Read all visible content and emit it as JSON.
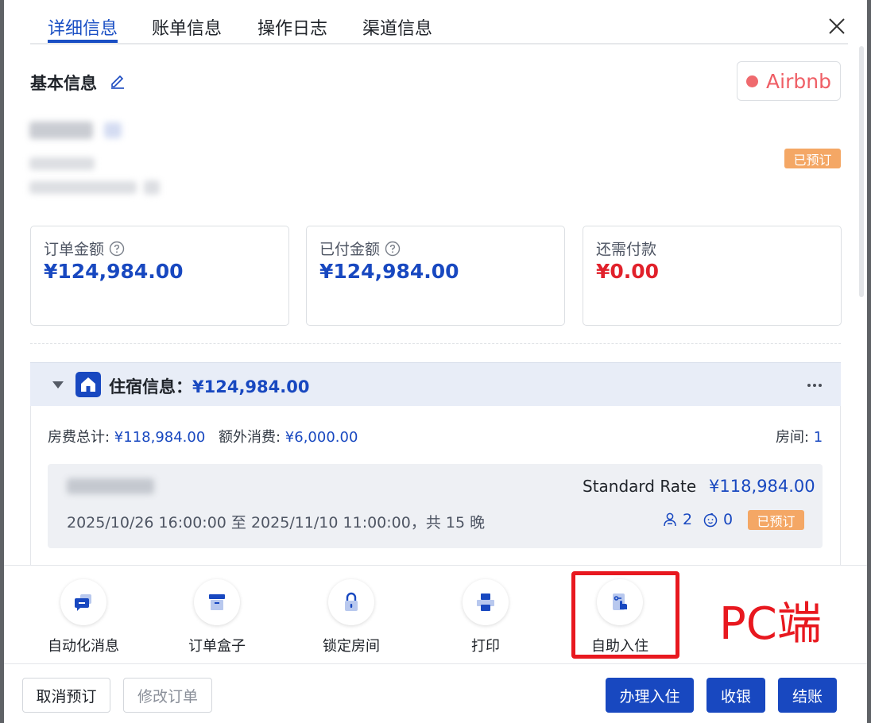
{
  "tabs": [
    "详细信息",
    "账单信息",
    "操作日志",
    "渠道信息"
  ],
  "basic": {
    "title": "基本信息",
    "channel": "Airbnb",
    "status": "已预订"
  },
  "amounts": {
    "order_label": "订单金额",
    "order_value": "¥124,984.00",
    "paid_label": "已付金额",
    "paid_value": "¥124,984.00",
    "due_label": "还需付款",
    "due_value": "¥0.00"
  },
  "lodging": {
    "title": "住宿信息：",
    "total": "¥124,984.00",
    "room_fee_label": "房费总计: ",
    "room_fee": "¥118,984.00",
    "extra_label": "额外消费: ",
    "extra": "¥6,000.00",
    "rooms_label": "房间: ",
    "rooms": "1",
    "rate_name": "Standard Rate",
    "rate_amount": "¥118,984.00",
    "date_range": "2025/10/26 16:00:00 至 2025/11/10 11:00:00，共 15 晚",
    "adults": "2",
    "children": "0",
    "room_status": "已预订"
  },
  "actions": [
    "自动化消息",
    "订单盒子",
    "锁定房间",
    "打印",
    "自助入住"
  ],
  "annotation": "PC端",
  "footer": {
    "cancel": "取消预订",
    "modify": "修改订单",
    "checkin": "办理入住",
    "cashier": "收银",
    "checkout": "结账"
  },
  "colors": {
    "primary": "#1848c0",
    "danger": "#e1212b",
    "status": "#f4a765",
    "airbnb": "#ef5f66"
  }
}
